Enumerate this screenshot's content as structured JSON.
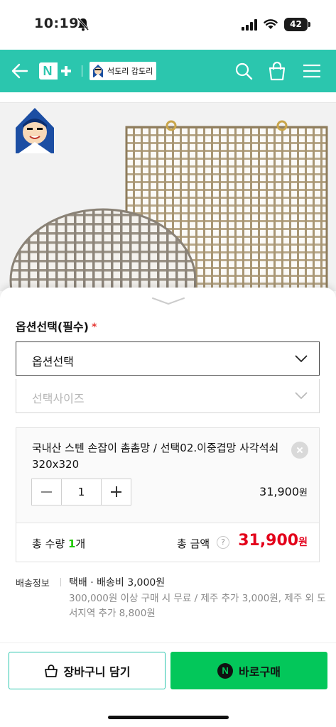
{
  "status_bar": {
    "time": "10:19",
    "battery": "42",
    "icons": [
      "bell-slash-icon",
      "signal-icon",
      "wifi-icon",
      "battery-icon"
    ]
  },
  "header": {
    "brand_n": "N",
    "store_name": "석도리 갑도리",
    "icons": [
      "back-arrow-icon",
      "search-icon",
      "shopping-bag-icon",
      "menu-icon"
    ],
    "background_color": "#2bc6ae"
  },
  "options": {
    "title": "옵션선택(필수)",
    "required_mark": "*",
    "select_main_label": "옵션선택",
    "select_size_label": "선택사이즈"
  },
  "selected_item": {
    "name": "국내산 스텐 손잡이 촘촘망 / 선택02.이중겹망 사각석쇠320x320",
    "quantity": "1",
    "price": "31,900",
    "price_unit": "원"
  },
  "total": {
    "qty_label": "총 수량",
    "qty_value": "1",
    "qty_unit": "개",
    "amount_label": "총 금액",
    "help": "?",
    "amount": "31,900",
    "amount_unit": "원",
    "price_color": "#e3001b"
  },
  "shipping": {
    "label": "배송정보",
    "line1": "택배 · 배송비 3,000원",
    "line2": "300,000원 이상 구매 시 무료 / 제주 추가 3,000원, 제주 외 도서지역 추가 8,800원"
  },
  "actions": {
    "cart_label": "장바구니 담기",
    "buy_label": "바로구매",
    "buy_icon_letter": "N",
    "buy_color": "#03c75a"
  }
}
